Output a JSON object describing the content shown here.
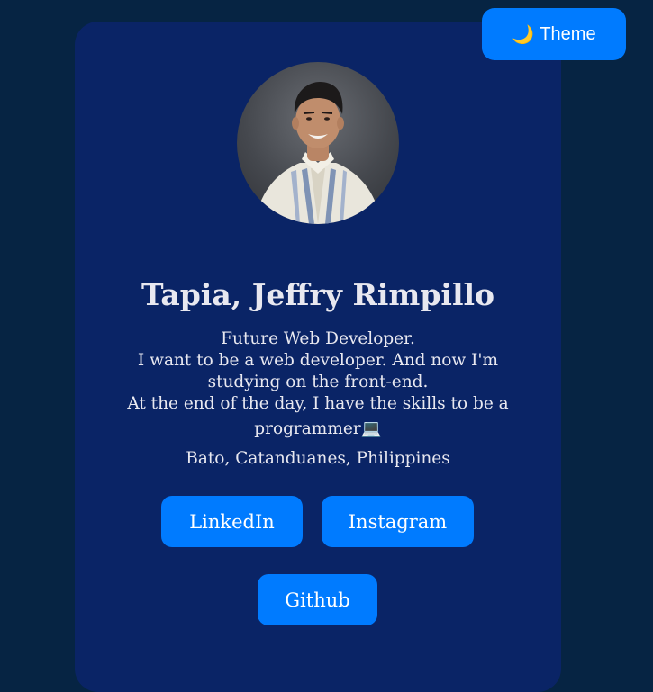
{
  "header": {
    "theme_button": {
      "icon": "moon-icon",
      "label": "Theme"
    }
  },
  "profile": {
    "name": "Tapia, Jeffry Rimpillo",
    "bio_lines": [
      "Future Web Developer.",
      "I want to be a web developer. And now I'm",
      "studying on the front-end.",
      "At the end of the day, I have the skills to be a",
      "programmer💻"
    ],
    "location": "Bato, Catanduanes, Philippines"
  },
  "links": {
    "linkedin": "LinkedIn",
    "instagram": "Instagram",
    "github": "Github"
  },
  "colors": {
    "page_background": "#062443",
    "card_background": "#0a2466",
    "button": "#007bff",
    "text": "#e8e8f0"
  }
}
